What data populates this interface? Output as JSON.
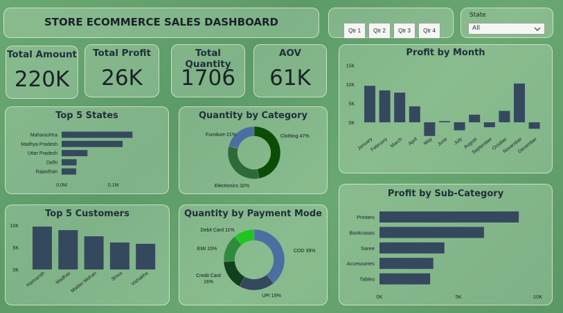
{
  "title": "STORE ECOMMERCE SALES DASHBOARD",
  "quarters": [
    "Qtr 1",
    "Qtr 2",
    "Qtr 3",
    "Qtr 4"
  ],
  "state_filter": {
    "label": "State",
    "value": "All"
  },
  "kpis": [
    {
      "label": "Total Amount",
      "value": "220K"
    },
    {
      "label": "Total Profit",
      "value": "26K"
    },
    {
      "label": "Total Quantity",
      "value": "1706"
    },
    {
      "label": "AOV",
      "value": "61K"
    }
  ],
  "bar_color": "#34495e",
  "chart_data": [
    {
      "id": "top_states",
      "type": "bar",
      "orientation": "horizontal",
      "title": "Top 5 States",
      "categories": [
        "Maharashtra",
        "Madhya Pradesh",
        "Uttar Pradesh",
        "Delhi",
        "Rajasthan"
      ],
      "values": [
        0.137,
        0.118,
        0.05,
        0.029,
        0.028
      ],
      "xlim": [
        0,
        0.15
      ],
      "xticks": [
        "0.0M",
        "0.1M"
      ],
      "xtick_values": [
        0,
        0.1
      ]
    },
    {
      "id": "qty_category",
      "type": "pie",
      "subtype": "donut",
      "title": "Quantity by Category",
      "labels": [
        "Clothing",
        "Electronics",
        "Furniture"
      ],
      "values": [
        47,
        32,
        21
      ],
      "display": [
        "Clothing 47%",
        "Electronics 32%",
        "Furniture 21%"
      ],
      "colors": [
        "#0b4d06",
        "#2d6a39",
        "#4a6fa0"
      ]
    },
    {
      "id": "top_customers",
      "type": "bar",
      "orientation": "vertical",
      "title": "Top 5 Customers",
      "categories": [
        "Harivansh",
        "Madhav",
        "Madan Mohan",
        "Shiva",
        "Vishakha"
      ],
      "values": [
        9700,
        8900,
        7500,
        6100,
        5800
      ],
      "ylim": [
        0,
        10000
      ],
      "yticks": [
        "0K",
        "5K",
        "10K"
      ],
      "ytick_values": [
        0,
        5000,
        10000
      ]
    },
    {
      "id": "qty_payment",
      "type": "pie",
      "subtype": "donut",
      "title": "Quantity by Payment Mode",
      "labels": [
        "COD",
        "UPI",
        "Credit Card",
        "EMI",
        "Debit Card"
      ],
      "values": [
        39,
        19,
        16,
        15,
        11
      ],
      "display": [
        "COD 39%",
        "UPI 19%",
        "Credit Card 16%",
        "EMI 15%",
        "Debit Card 11%"
      ],
      "colors": [
        "#4a6fa0",
        "#34495e",
        "#12401c",
        "#2e8b3e",
        "#22c41f"
      ]
    },
    {
      "id": "profit_month",
      "type": "bar",
      "orientation": "vertical",
      "title": "Profit by Month",
      "categories": [
        "January",
        "February",
        "March",
        "April",
        "May",
        "June",
        "July",
        "August",
        "September",
        "October",
        "November",
        "December"
      ],
      "values": [
        9600,
        8400,
        7800,
        4200,
        -3600,
        300,
        -2100,
        2000,
        -1300,
        3000,
        10200,
        -1700
      ],
      "ylim": [
        -5000,
        15000
      ],
      "yticks": [
        "0K",
        "5K",
        "10K",
        "15K"
      ],
      "ytick_values": [
        0,
        5000,
        10000,
        15000
      ]
    },
    {
      "id": "profit_subcat",
      "type": "bar",
      "orientation": "horizontal",
      "title": "Profit by Sub-Category",
      "categories": [
        "Printers",
        "Bookcases",
        "Saree",
        "Accessories",
        "Tables"
      ],
      "values": [
        8800,
        6600,
        4100,
        3400,
        3200
      ],
      "xlim": [
        0,
        10500
      ],
      "xticks": [
        "0K",
        "5K",
        "10K"
      ],
      "xtick_values": [
        0,
        5000,
        10000
      ]
    }
  ]
}
